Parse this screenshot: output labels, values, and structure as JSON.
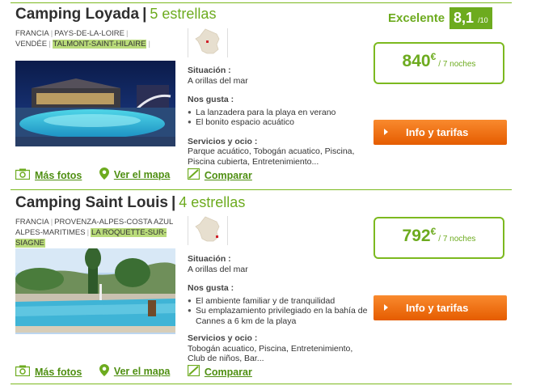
{
  "listings": [
    {
      "name": "Camping Loyada",
      "stars": "5 estrellas",
      "location": {
        "country": "FRANCIA",
        "region": "PAYS-DE-LA-LOIRE",
        "dept": "VENDÉE",
        "town": "TALMONT-SAINT-HILAIRE"
      },
      "rating": {
        "word": "Excelente",
        "score": "8,1",
        "scale": "/10"
      },
      "situacion_label": "Situación :",
      "situacion": "A orillas del mar",
      "nos_gusta_label": "Nos gusta :",
      "likes": [
        "La lanzadera para la playa en verano",
        "El bonito espacio acuático"
      ],
      "servicios_label": "Servicios y ocio :",
      "servicios": "Parque acuático, Tobogán acuatico, Piscina, Piscina cubierta, Entretenimiento...",
      "price": "840",
      "currency": "€",
      "nights": "/ 7 noches",
      "cta": "Info y tarifas",
      "links": {
        "photos": "Más fotos",
        "map": "Ver el mapa",
        "compare": "Comparar"
      }
    },
    {
      "name": "Camping Saint Louis",
      "stars": "4 estrellas",
      "location": {
        "country": "FRANCIA",
        "region": "PROVENZA-ALPES-COSTA AZUL",
        "dept": "ALPES-MARITIMES",
        "town": "LA ROQUETTE-SUR-SIAGNE"
      },
      "situacion_label": "Situación :",
      "situacion": "A orillas del mar",
      "nos_gusta_label": "Nos gusta :",
      "likes": [
        "El ambiente familiar y de tranquilidad",
        "Su emplazamiento privilegiado en la bahía de Cannes a 6 km de la playa"
      ],
      "servicios_label": "Servicios y ocio :",
      "servicios": "Tobogán acuatico, Piscina, Entretenimiento, Club de niños, Bar...",
      "price": "792",
      "currency": "€",
      "nights": "/ 7 noches",
      "cta": "Info y tarifas",
      "links": {
        "photos": "Más fotos",
        "map": "Ver el mapa",
        "compare": "Comparar"
      }
    }
  ],
  "colors": {
    "accent": "#6dab1f",
    "cta": "#f07a1a",
    "highlight": "#b9db7a"
  }
}
